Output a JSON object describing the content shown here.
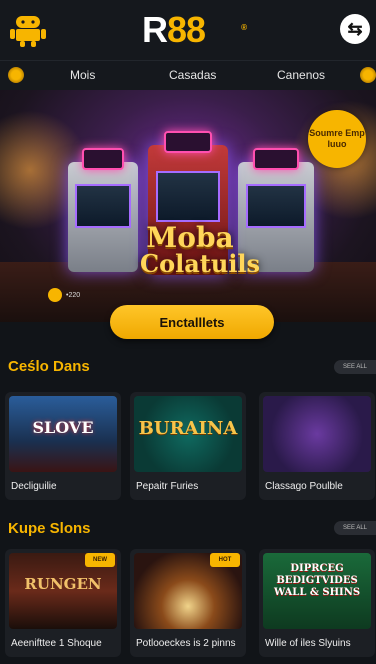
{
  "header": {
    "logo_left": "R",
    "logo_right": "88",
    "logo_mark": "®",
    "left_icon": "android-icon",
    "right_icon": "user-swap-icon"
  },
  "nav": {
    "items": [
      "Mois",
      "Casadas",
      "Canenos"
    ]
  },
  "hero": {
    "title_line1": "Moba",
    "title_line2": "Colatuils",
    "badge_text": "Soumre Emp luuo",
    "coin_text": "•220",
    "cta_label": "Enctalllets"
  },
  "sections": [
    {
      "title": "Ceślo Dans",
      "see_all": "SEE ALL",
      "cards": [
        {
          "label": "Decliguilie",
          "art": "SLOVE"
        },
        {
          "label": "Pepaitr Furies",
          "art": "BURAINA"
        },
        {
          "label": "Classago Poulble",
          "art": ""
        }
      ]
    },
    {
      "title": "Kupe Slons",
      "see_all": "SEE ALL",
      "cards": [
        {
          "label": "Aeenifttee 1 Shoque",
          "art": "RUNGEN",
          "tag": "NEW"
        },
        {
          "label": "Potlooeckes is 2 pinns",
          "art": "",
          "tag": "HOT"
        },
        {
          "label": "Wille of iles Slyuins",
          "art": "DIPRCEG BEDIGTVIDES WALL & SHINS",
          "tag": ""
        }
      ]
    }
  ],
  "colors": {
    "accent": "#f7b500",
    "bg": "#111418"
  }
}
